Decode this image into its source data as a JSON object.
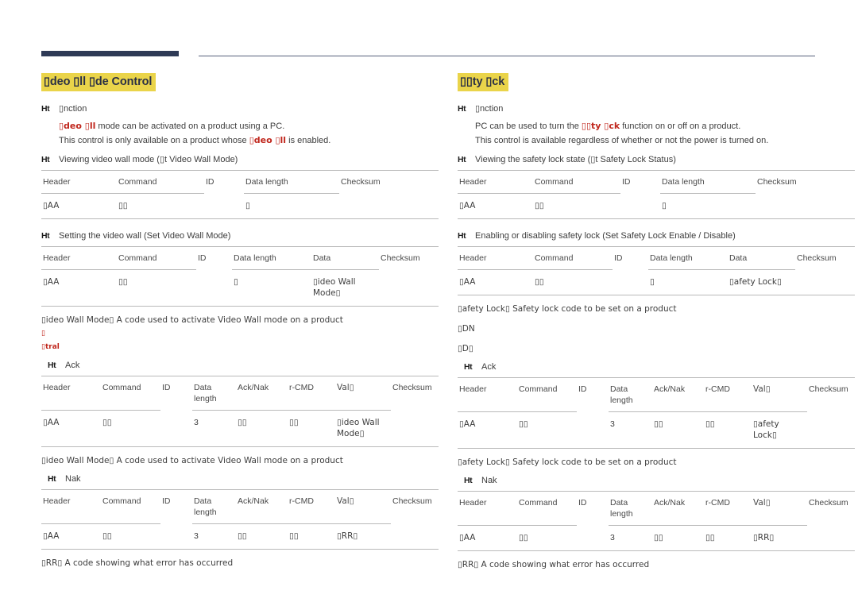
{
  "document": {
    "page_type": "protocol-reference",
    "colors": {
      "highlight": "#ead44a",
      "title_text": "#2b3045",
      "accent_red": "#c0261c",
      "rule_navy": "#2e3a56"
    }
  },
  "common": {
    "bullet_glyph": "Ht",
    "labels": {
      "function": "▯nction",
      "ack": "Ack",
      "nak": "Nak"
    },
    "columns_basic": [
      "Header",
      "Command",
      "ID",
      "Data length",
      "Checksum"
    ],
    "columns_with_data": [
      "Header",
      "Command",
      "ID",
      "Data length",
      "Data",
      "Checksum"
    ],
    "columns_ack": [
      "Header",
      "Command",
      "ID",
      "Data length",
      "Ack/Nak",
      "r-CMD",
      "Val▯",
      "Checksum"
    ],
    "data_length_value": "▯",
    "ack_length_value": "3",
    "header_value": "▯AA",
    "error_note": "▯RR▯ A code showing what error has occurred"
  },
  "left": {
    "title": "▯deo ▯ll ▯de Control",
    "function_lines": [
      "▯deo ▯ll mode can be activated on a product using a PC.",
      "This control is only available on a product whose ▯deo ▯ll is enabled."
    ],
    "function_red_1": "▯deo ▯ll",
    "function_red_2": "▯deo ▯ll",
    "view_label": "Viewing video wall mode (▯t Video Wall Mode)",
    "set_label": "Setting the video wall (Set Video Wall Mode)",
    "view_table": {
      "headers": [
        "Header",
        "Command",
        "ID",
        "Data length",
        "Checksum"
      ],
      "row": [
        "▯AA",
        "▯▯",
        "",
        "▯",
        ""
      ]
    },
    "set_table": {
      "headers": [
        "Header",
        "Command",
        "ID",
        "Data length",
        "Data",
        "Checksum"
      ],
      "row": [
        "▯AA",
        "▯▯",
        "",
        "▯",
        "▯ideo Wall Mode▯",
        ""
      ]
    },
    "mode_note": "▯ideo Wall Mode▯ A code used to activate Video Wall mode on a product",
    "red_note_1": "▯",
    "red_note_2": "▯tral",
    "ack_table": {
      "headers": [
        "Header",
        "Command",
        "ID",
        "Data",
        "Ack/Nak",
        "r-CMD",
        "Val▯",
        "Checksum"
      ],
      "headers_sub": [
        "",
        "",
        "",
        "length",
        "",
        "",
        "",
        ""
      ],
      "row": [
        "▯AA",
        "▯▯",
        "",
        "3",
        "▯▯",
        "▯▯",
        "▯ideo Wall Mode▯",
        ""
      ]
    },
    "nak_note": "▯ideo Wall Mode▯ A code used to activate Video Wall mode on a product",
    "nak_table": {
      "headers": [
        "Header",
        "Command",
        "ID",
        "Data",
        "Ack/Nak",
        "r-CMD",
        "Val▯",
        "Checksum"
      ],
      "headers_sub": [
        "",
        "",
        "",
        "length",
        "",
        "",
        "",
        ""
      ],
      "row": [
        "▯AA",
        "▯▯",
        "",
        "3",
        "▯▯",
        "▯▯",
        "▯RR▯",
        ""
      ]
    },
    "error_note": "▯RR▯ A code showing what error has occurred"
  },
  "right": {
    "title": "▯▯ty ▯ck",
    "function_lines": [
      "PC can be used to turn the ▯▯ty ▯ck function on or off on a product.",
      "This control is available regardless of whether or not the power is turned on."
    ],
    "function_red_1": "▯▯ty ▯ck",
    "view_label": "Viewing the safety lock state (▯t Safety Lock Status)",
    "set_label": "Enabling or disabling safety lock (Set Safety Lock Enable / Disable)",
    "view_table": {
      "headers": [
        "Header",
        "Command",
        "ID",
        "Data length",
        "Checksum"
      ],
      "row": [
        "▯AA",
        "▯▯",
        "",
        "▯",
        ""
      ]
    },
    "set_table": {
      "headers": [
        "Header",
        "Command",
        "ID",
        "Data length",
        "Data",
        "Checksum"
      ],
      "row": [
        "▯AA",
        "▯▯",
        "",
        "▯",
        "▯afety Lock▯",
        ""
      ]
    },
    "lock_note": "▯afety Lock▯ Safety lock code to be set on a product",
    "value_on": "▯DN",
    "value_off": "▯D▯",
    "ack_table": {
      "headers": [
        "Header",
        "Command",
        "ID",
        "Data",
        "Ack/Nak",
        "r-CMD",
        "Val▯",
        "Checksum"
      ],
      "headers_sub": [
        "",
        "",
        "",
        "length",
        "",
        "",
        "",
        ""
      ],
      "row": [
        "▯AA",
        "▯▯",
        "",
        "3",
        "▯▯",
        "▯▯",
        "▯afety Lock▯",
        ""
      ]
    },
    "nak_note": "▯afety Lock▯ Safety lock code to be set on a product",
    "nak_table": {
      "headers": [
        "Header",
        "Command",
        "ID",
        "Data",
        "Ack/Nak",
        "r-CMD",
        "Val▯",
        "Checksum"
      ],
      "headers_sub": [
        "",
        "",
        "",
        "length",
        "",
        "",
        "",
        ""
      ],
      "row": [
        "▯AA",
        "▯▯",
        "",
        "3",
        "▯▯",
        "▯▯",
        "▯RR▯",
        ""
      ]
    },
    "error_note": "▯RR▯ A code showing what error has occurred"
  }
}
